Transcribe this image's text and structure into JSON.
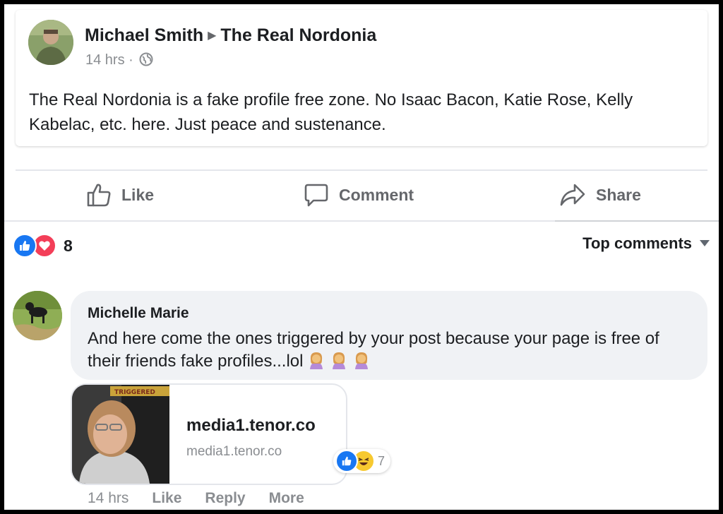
{
  "post": {
    "author": "Michael Smith",
    "group": "The Real Nordonia",
    "time": "14 hrs",
    "separator": "·",
    "text": "The Real Nordonia is a fake profile free zone. No Isaac Bacon, Katie Rose, Kelly Kabelac, etc. here. Just peace and sustenance."
  },
  "actions": {
    "like": "Like",
    "comment": "Comment",
    "share": "Share"
  },
  "reactions": {
    "icons": [
      "like-icon",
      "love-icon"
    ],
    "count": "8",
    "sort_label": "Top comments"
  },
  "comment": {
    "author": "Michelle Marie",
    "text": "And here come the ones triggered by your post because your page is free of their friends fake profiles...lol",
    "emoji": [
      "woman-facepalming",
      "woman-facepalming",
      "woman-facepalming"
    ],
    "link": {
      "title": "media1.tenor.co",
      "url": "media1.tenor.co",
      "thumb_caption": "TRIGGERED"
    },
    "reaction_icons": [
      "like-icon",
      "haha-icon"
    ],
    "reaction_count": "7",
    "time": "14 hrs",
    "like_label": "Like",
    "reply_label": "Reply",
    "more_label": "More"
  },
  "colors": {
    "like_blue": "#1877f2",
    "love_red": "#f33e58",
    "bubble_bg": "#f0f2f5",
    "muted_text": "#65676b"
  }
}
